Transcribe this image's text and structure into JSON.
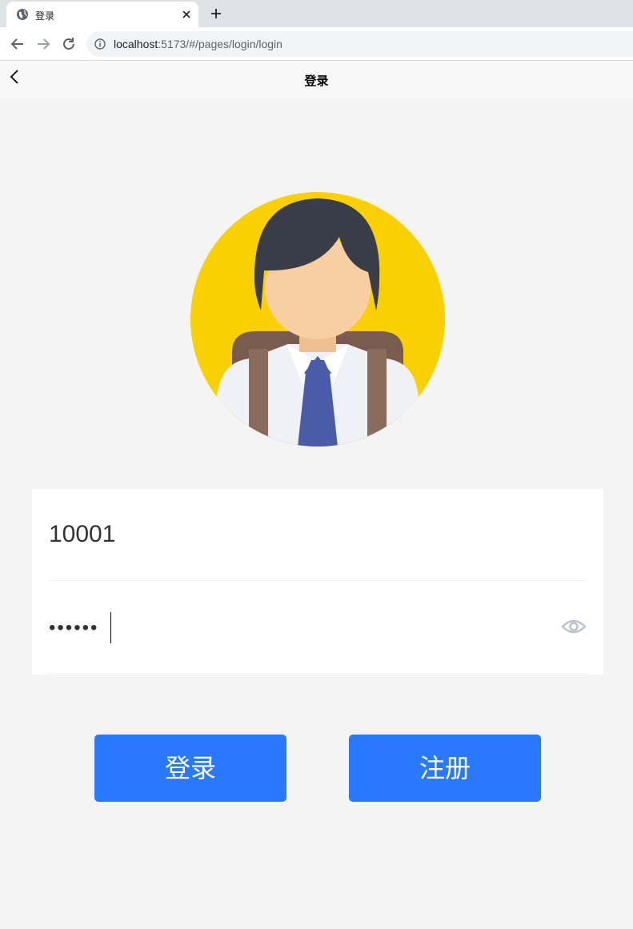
{
  "browser": {
    "tab_title": "登录",
    "url_host": "localhost",
    "url_rest": ":5173/#/pages/login/login"
  },
  "nav": {
    "title": "登录"
  },
  "form": {
    "username_value": "10001",
    "password_masked": "••••••"
  },
  "buttons": {
    "login_label": "登录",
    "register_label": "注册"
  },
  "colors": {
    "primary": "#2979ff",
    "avatar_bg": "#fbd000"
  }
}
